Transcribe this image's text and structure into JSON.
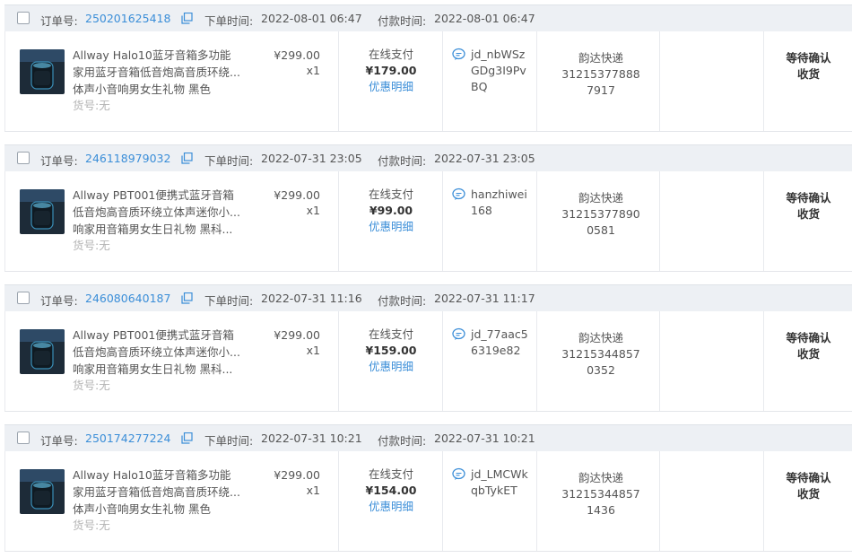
{
  "labels": {
    "order_no": "订单号:",
    "order_time": "下单时间:",
    "pay_time": "付款时间:",
    "sku": "货号:无",
    "pay_method": "在线支付",
    "discount_detail": "优惠明细",
    "courier": "韵达快递",
    "status": "等待确认收货"
  },
  "icons": {
    "copy": "copy-icon",
    "buyer": "chat-bubble-icon",
    "checkbox": "checkbox"
  },
  "colors": {
    "link": "#3b8ed8",
    "header_bg": "#edf0f4"
  },
  "orders": [
    {
      "order_no": "250201625418",
      "order_time": "2022-08-01 06:47",
      "pay_time": "2022-08-01 06:47",
      "title_lines": [
        "Allway Halo10蓝牙音箱多功能",
        "家用蓝牙音箱低音炮高音质环绕...",
        "体声小音响男女生礼物 黑色"
      ],
      "price": "¥299.00",
      "qty": "x1",
      "paid": "¥179.00",
      "buyer": "jd_nbWSzGDg3I9PvBQ",
      "tracking": "312153778887917",
      "status_line1": "等待确认",
      "status_line2": "收货"
    },
    {
      "order_no": "246118979032",
      "order_time": "2022-07-31 23:05",
      "pay_time": "2022-07-31 23:05",
      "title_lines": [
        "Allway PBT001便携式蓝牙音箱",
        "低音炮高音质环绕立体声迷你小...",
        "响家用音箱男女生日礼物 黑科..."
      ],
      "price": "¥299.00",
      "qty": "x1",
      "paid": "¥99.00",
      "buyer": "hanzhiwei168",
      "tracking": "312153778900581",
      "status_line1": "等待确认",
      "status_line2": "收货"
    },
    {
      "order_no": "246080640187",
      "order_time": "2022-07-31 11:16",
      "pay_time": "2022-07-31 11:17",
      "title_lines": [
        "Allway PBT001便携式蓝牙音箱",
        "低音炮高音质环绕立体声迷你小...",
        "响家用音箱男女生日礼物 黑科..."
      ],
      "price": "¥299.00",
      "qty": "x1",
      "paid": "¥159.00",
      "buyer": "jd_77aac56319e82",
      "tracking": "312153448570352",
      "status_line1": "等待确认",
      "status_line2": "收货"
    },
    {
      "order_no": "250174277224",
      "order_time": "2022-07-31 10:21",
      "pay_time": "2022-07-31 10:21",
      "title_lines": [
        "Allway Halo10蓝牙音箱多功能",
        "家用蓝牙音箱低音炮高音质环绕...",
        "体声小音响男女生礼物 黑色"
      ],
      "price": "¥299.00",
      "qty": "x1",
      "paid": "¥154.00",
      "buyer": "jd_LMCWkqbTykET",
      "tracking": "312153448571436",
      "status_line1": "等待确认",
      "status_line2": "收货"
    }
  ]
}
